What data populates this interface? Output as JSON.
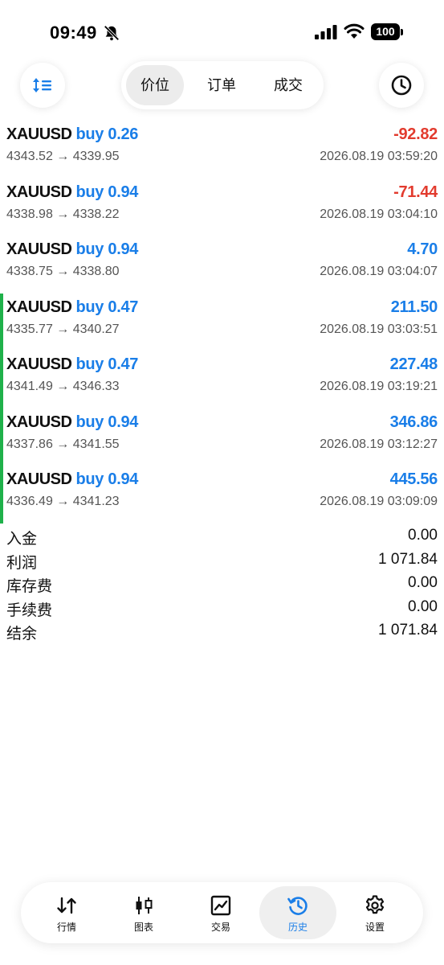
{
  "status": {
    "time": "09:49",
    "battery": "100"
  },
  "toolbar": {
    "segments": [
      "价位",
      "订单",
      "成交"
    ],
    "active_segment": 0
  },
  "deals": [
    {
      "symbol": "XAUUSD",
      "side": "buy 0.26",
      "profit": "-92.82",
      "prices": "4343.52 → 4339.95",
      "time": "2026.08.19 03:59:20",
      "marked": false
    },
    {
      "symbol": "XAUUSD",
      "side": "buy 0.94",
      "profit": "-71.44",
      "prices": "4338.98 → 4338.22",
      "time": "2026.08.19 03:04:10",
      "marked": false
    },
    {
      "symbol": "XAUUSD",
      "side": "buy 0.94",
      "profit": "4.70",
      "prices": "4338.75 → 4338.80",
      "time": "2026.08.19 03:04:07",
      "marked": false
    },
    {
      "symbol": "XAUUSD",
      "side": "buy 0.47",
      "profit": "211.50",
      "prices": "4335.77 → 4340.27",
      "time": "2026.08.19 03:03:51",
      "marked": true
    },
    {
      "symbol": "XAUUSD",
      "side": "buy 0.47",
      "profit": "227.48",
      "prices": "4341.49 → 4346.33",
      "time": "2026.08.19 03:19:21",
      "marked": true
    },
    {
      "symbol": "XAUUSD",
      "side": "buy 0.94",
      "profit": "346.86",
      "prices": "4337.86 → 4341.55",
      "time": "2026.08.19 03:12:27",
      "marked": true
    },
    {
      "symbol": "XAUUSD",
      "side": "buy 0.94",
      "profit": "445.56",
      "prices": "4336.49 → 4341.23",
      "time": "2026.08.19 03:09:09",
      "marked": true
    }
  ],
  "summary": [
    {
      "label": "入金",
      "value": "0.00"
    },
    {
      "label": "利润",
      "value": "1 071.84"
    },
    {
      "label": "库存费",
      "value": "0.00"
    },
    {
      "label": "手续费",
      "value": "0.00"
    },
    {
      "label": "结余",
      "value": "1 071.84"
    }
  ],
  "nav": [
    {
      "label": "行情",
      "icon": "quotes-icon"
    },
    {
      "label": "图表",
      "icon": "chart-icon"
    },
    {
      "label": "交易",
      "icon": "trade-icon"
    },
    {
      "label": "历史",
      "icon": "history-icon"
    },
    {
      "label": "设置",
      "icon": "gear-icon"
    }
  ],
  "nav_active": 3,
  "colors": {
    "accent": "#1a7ee8",
    "loss": "#e23b2e",
    "marker": "#1fb14a"
  }
}
